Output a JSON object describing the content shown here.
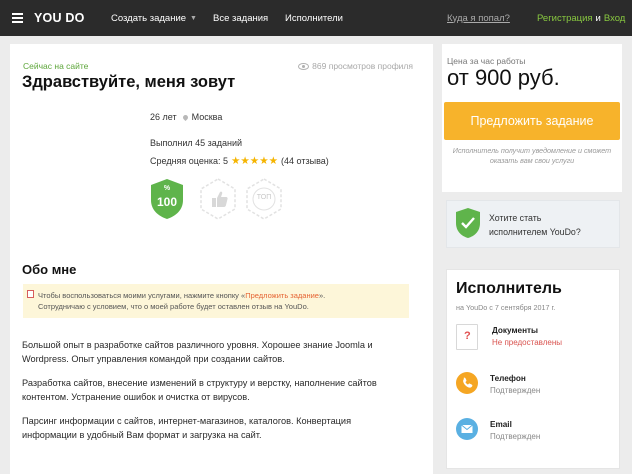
{
  "topbar": {
    "logo": "YOU DO",
    "nav": [
      {
        "label": "Создать задание"
      },
      {
        "label": "Все задания"
      },
      {
        "label": "Исполнители"
      }
    ],
    "lost": "Куда я попал?",
    "register": "Регистрация",
    "and": "и",
    "login": "Вход"
  },
  "profile": {
    "online": "Сейчас на сайте",
    "views": "869 просмотров профиля",
    "greeting": "Здравствуйте, меня зовут",
    "age": "26 лет",
    "city": "Москва",
    "completed": "Выполнил 45 заданий",
    "rating_label": "Средняя оценка: 5",
    "rating_stars": 5,
    "reviews": "(44 отзыва)",
    "badge_percent": "%",
    "badge_score": "100",
    "badge_top": "ТОП"
  },
  "about": {
    "title": "Обо мне",
    "notice_before": "Чтобы воспользоваться моими услугами, нажмите кнопку «",
    "notice_link": "Предложить задание",
    "notice_after": "».",
    "notice_line2": "Сотрудничаю с условием, что о моей работе будет оставлен отзыв на YouDo.",
    "paragraphs": [
      "Большой опыт в разработке сайтов различного уровня. Хорошее знание Joomla и Wordpress. Опыт управления командой при создании сайтов.",
      "Разработка сайтов, внесение изменений в структуру и верстку, наполнение сайтов контентом. Устранение ошибок и очистка от вирусов.",
      "Парсинг информации с сайтов, интернет-магазинов, каталогов. Конвертация информации в удобный Вам формат и загрузка на сайт."
    ]
  },
  "price": {
    "label": "Цена за час работы",
    "value": "от 900 руб.",
    "button": "Предложить задание",
    "hint": "Исполнитель получит уведомление и сможет оказать вам свои услуги"
  },
  "become": {
    "line1": "Хотите стать",
    "line2": "исполнителем YouDo?"
  },
  "executor": {
    "title": "Исполнитель",
    "since": "на YouDo с 7 сентября 2017 г.",
    "rows": [
      {
        "title": "Документы",
        "status": "Не предоставлены"
      },
      {
        "title": "Телефон",
        "status": "Подтвержден"
      },
      {
        "title": "Email",
        "status": "Подтвержден"
      }
    ]
  },
  "colors": {
    "accent_green": "#5da63a",
    "orange_button": "#f7b32b",
    "star": "#f5b400",
    "topbar": "#2b2b2b"
  }
}
